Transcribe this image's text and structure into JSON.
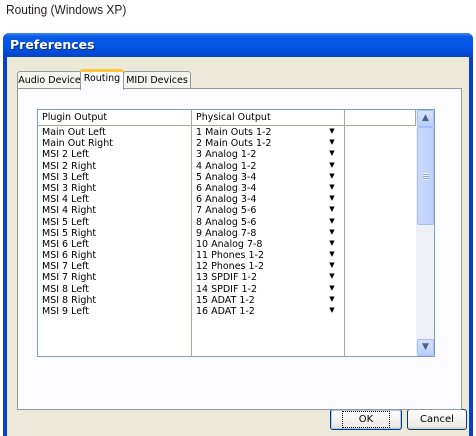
{
  "caption": "Routing (Windows XP)",
  "window": {
    "title": "Preferences"
  },
  "tabs": [
    {
      "label": "Audio Device",
      "active": false
    },
    {
      "label": "Routing",
      "active": true
    },
    {
      "label": "MIDI Devices",
      "active": false
    }
  ],
  "table": {
    "columns": [
      "Plugin Output",
      "Physical Output"
    ],
    "rows": [
      {
        "plugin": "Main Out Left",
        "physical": "1 Main Outs 1-2"
      },
      {
        "plugin": "Main Out Right",
        "physical": "2 Main Outs 1-2"
      },
      {
        "plugin": "MSI 2 Left",
        "physical": "3 Analog 1-2"
      },
      {
        "plugin": "MSI 2 Right",
        "physical": "4 Analog 1-2"
      },
      {
        "plugin": "MSI 3 Left",
        "physical": "5 Analog 3-4"
      },
      {
        "plugin": "MSI 3 Right",
        "physical": "6 Analog 3-4"
      },
      {
        "plugin": "MSI 4 Left",
        "physical": "6 Analog 3-4"
      },
      {
        "plugin": "MSI 4 Right",
        "physical": "7 Analog 5-6"
      },
      {
        "plugin": "MSI 5 Left",
        "physical": "8 Analog 5-6"
      },
      {
        "plugin": "MSI 5 Right",
        "physical": "9 Analog 7-8"
      },
      {
        "plugin": "MSI 6 Left",
        "physical": "10 Analog 7-8"
      },
      {
        "plugin": "MSI 6 Right",
        "physical": "11 Phones 1-2"
      },
      {
        "plugin": "MSI 7 Left",
        "physical": "12 Phones 1-2"
      },
      {
        "plugin": "MSI 7 Right",
        "physical": "13 SPDIF 1-2"
      },
      {
        "plugin": "MSI 8 Left",
        "physical": "14 SPDIF 1-2"
      },
      {
        "plugin": "MSI 8 Right",
        "physical": "15 ADAT 1-2"
      },
      {
        "plugin": "MSI 9 Left",
        "physical": "16 ADAT 1-2"
      }
    ]
  },
  "buttons": {
    "ok": "OK",
    "cancel": "Cancel"
  },
  "icons": {
    "dropdown": "dropdown-arrow-icon",
    "scroll_up": "scroll-up-arrow-icon",
    "scroll_down": "scroll-down-arrow-icon"
  },
  "colors": {
    "titlebar": "#0254e6",
    "dialog_bg": "#ece9d8",
    "tab_highlight": "#ffc83c",
    "button_border": "#003c74"
  }
}
